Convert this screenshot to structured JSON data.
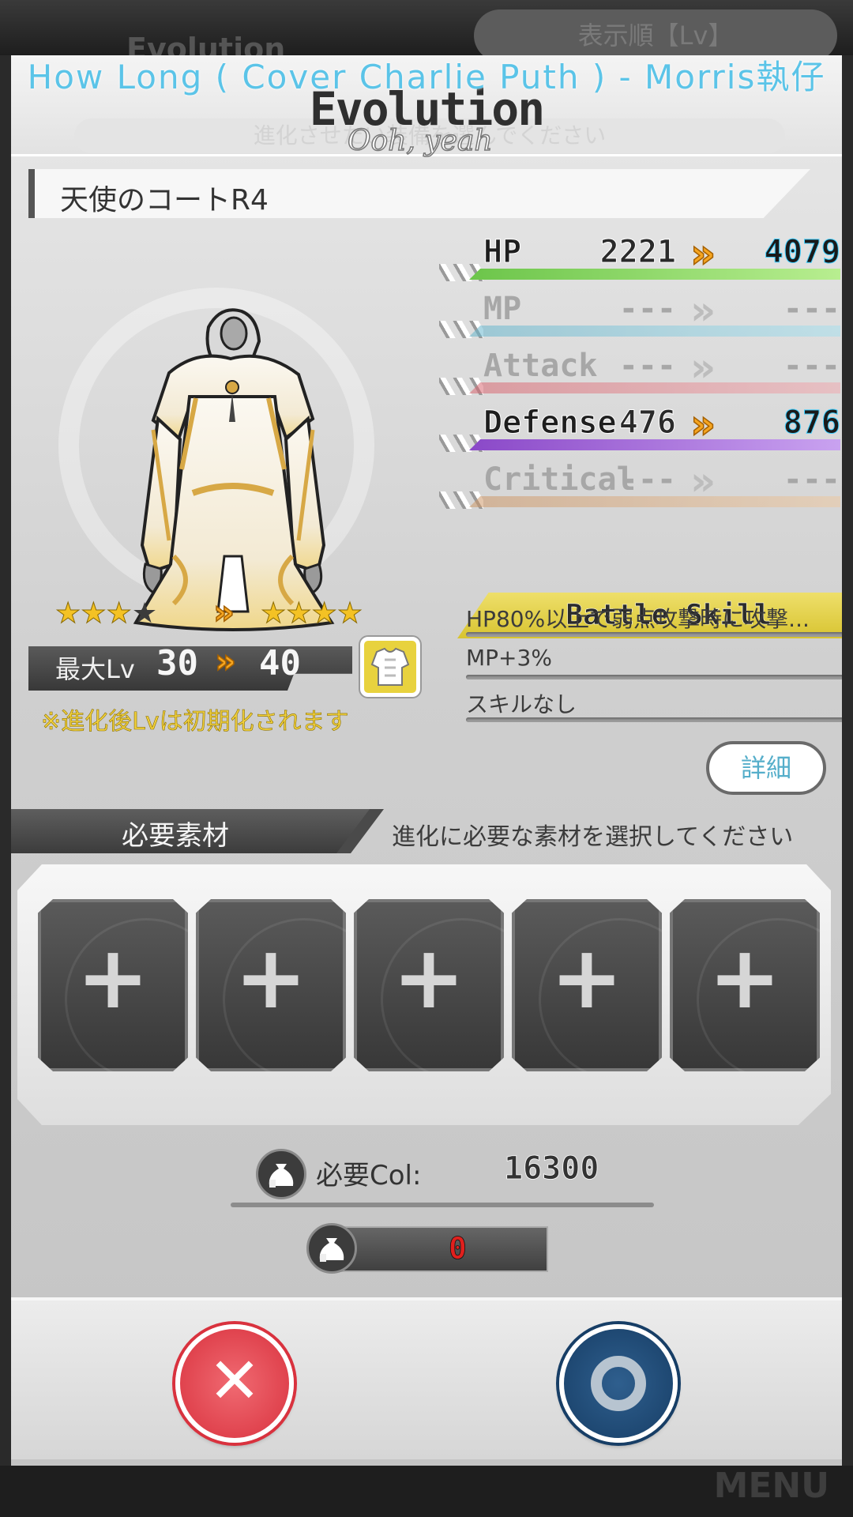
{
  "background": {
    "sort_button": "表示順【Lv】",
    "ghost_title": "Evolution",
    "menu_label": "MENU"
  },
  "lyrics": {
    "line1": "How Long ( Cover Charlie Puth ) - Morris執仔",
    "line2": "Ooh, yeah"
  },
  "header": {
    "title": "Evolution",
    "subtitle": "進化させたい装備を選んでください"
  },
  "item": {
    "name": "天使のコートR4"
  },
  "stats": [
    {
      "label": "HP",
      "old": "2221",
      "new": "4079",
      "active": true,
      "color": "#8fd86a"
    },
    {
      "label": "MP",
      "old": "---",
      "new": "---",
      "active": false,
      "color": "#7fc8dc"
    },
    {
      "label": "Attack",
      "old": "---",
      "new": "---",
      "active": false,
      "color": "#e07c84"
    },
    {
      "label": "Defense",
      "old": "476",
      "new": "876",
      "active": true,
      "color": "#9b5cd6"
    },
    {
      "label": "Critical",
      "old": "---",
      "new": "---",
      "active": false,
      "color": "#d8a87a"
    }
  ],
  "battle_skill": {
    "header": "Battle Skill",
    "skills": [
      "HP80%以上で弱点攻撃時に攻撃...",
      "MP+3%",
      "スキルなし"
    ]
  },
  "detail_button": "詳細",
  "rarity": {
    "old_stars": "★★★",
    "old_empty": "★",
    "new_stars": "★★★★",
    "arrow": "»"
  },
  "level": {
    "label": "最大Lv",
    "old": "30",
    "new": "40",
    "arrow": "»",
    "note": "※進化後Lvは初期化されます"
  },
  "materials": {
    "header": "必要素材",
    "hint": "進化に必要な素材を選択してください",
    "slots": [
      "+",
      "+",
      "+",
      "+",
      "+"
    ]
  },
  "col": {
    "label": "必要Col:",
    "required": "16300",
    "owned": "0"
  },
  "buttons": {
    "cancel": "✕"
  },
  "colors": {
    "accent_gold": "#f5a520",
    "skill_yellow": "#e6d44a",
    "cancel_red": "#d9323e",
    "ok_blue": "#173e66"
  }
}
